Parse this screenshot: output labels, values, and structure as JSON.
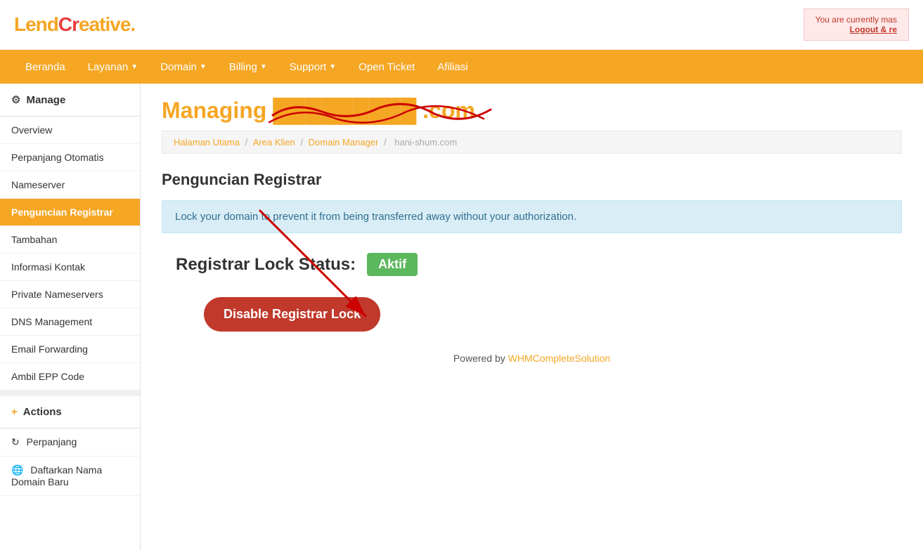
{
  "topbar": {
    "logo": "LendCreative.",
    "notice_line1": "You are currently mas",
    "notice_link": "Logout & re"
  },
  "nav": {
    "items": [
      {
        "label": "Beranda",
        "has_arrow": false
      },
      {
        "label": "Layanan",
        "has_arrow": true
      },
      {
        "label": "Domain",
        "has_arrow": true
      },
      {
        "label": "Billing",
        "has_arrow": true
      },
      {
        "label": "Support",
        "has_arrow": true
      },
      {
        "label": "Open Ticket",
        "has_arrow": false
      },
      {
        "label": "Afiliasi",
        "has_arrow": false
      }
    ]
  },
  "sidebar": {
    "manage_title": "Manage",
    "manage_items": [
      {
        "label": "Overview",
        "active": false
      },
      {
        "label": "Perpanjang Otomatis",
        "active": false
      },
      {
        "label": "Nameserver",
        "active": false
      },
      {
        "label": "Penguncian Registrar",
        "active": true
      },
      {
        "label": "Tambahan",
        "active": false
      },
      {
        "label": "Informasi Kontak",
        "active": false
      },
      {
        "label": "Private Nameservers",
        "active": false
      },
      {
        "label": "DNS Management",
        "active": false
      },
      {
        "label": "Email Forwarding",
        "active": false
      },
      {
        "label": "Ambil EPP Code",
        "active": false
      }
    ],
    "actions_title": "Actions",
    "actions_items": [
      {
        "label": "Perpanjang",
        "icon": "refresh"
      },
      {
        "label": "Daftarkan Nama Domain Baru",
        "icon": "globe"
      }
    ]
  },
  "main": {
    "page_title": "Managing ██████████.com",
    "page_title_visible": "Managing",
    "page_title_domain": ".com",
    "breadcrumbs": [
      {
        "label": "Halaman Utama",
        "link": true
      },
      {
        "label": "Area Klien",
        "link": true
      },
      {
        "label": "Domain Manager",
        "link": true
      },
      {
        "label": "hani-shum.com",
        "link": false
      }
    ],
    "section_heading": "Penguncian Registrar",
    "info_text": "Lock your domain to prevent it from being transferred away without your authorization.",
    "lock_status_label": "Registrar Lock Status:",
    "lock_status_value": "Aktif",
    "disable_button": "Disable Registrar Lock",
    "powered_by_text": "Powered by",
    "powered_by_link": "WHMCompleteSolution"
  }
}
